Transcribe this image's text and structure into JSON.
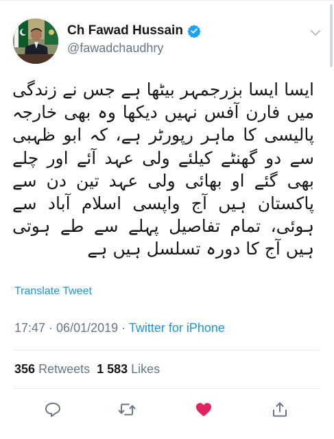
{
  "header": {
    "display_name": "Ch Fawad Hussain",
    "handle": "@fawadchaudhry",
    "verified_icon": "verified-badge-icon",
    "menu_icon": "chevron-down-icon"
  },
  "tweet": {
    "text": "ایسا ایسا بزرجمہر بیٹھا ہے جس نے زندگی میں فارن آفس نہیں دیکھا وہ بھی خارجہ پالیسی کا ماہر رپورٹر ہے، کہ ابو ظہبی سے دو گھنٹے کیلئے ولی عہد آئے اور چلے بھی گئے او بھائی ولی عہد تین دن سے پاکستان ہیں آج واپسی اسلام آباد سے ہوئی، تمام تفاصیل پہلے سے طے ہوتی ہیں آج کا دورہ تسلسل ہیں ہے",
    "translate_label": "Translate Tweet",
    "time": "17:47",
    "separator_1": " · ",
    "date": "06/01/2019",
    "separator_2": " · ",
    "source": "Twitter for iPhone"
  },
  "stats": {
    "retweets_count": "356",
    "retweets_label": "Retweets",
    "likes_count": "1 583",
    "likes_label": "Likes"
  },
  "actions": {
    "reply_icon": "reply-icon",
    "retweet_icon": "retweet-icon",
    "like_icon": "heart-icon",
    "share_icon": "share-icon",
    "like_color": "#e0245e",
    "icon_color": "#657786"
  },
  "colors": {
    "link": "#1b95e0",
    "secondary_text": "#657786",
    "primary_text": "#14171a",
    "verified": "#1da1f2"
  }
}
